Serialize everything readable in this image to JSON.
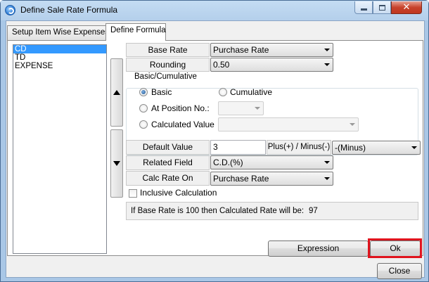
{
  "window": {
    "title": "Define Sale Rate Formula"
  },
  "tabs": [
    {
      "label": "Setup Item Wise Expenses",
      "active": false
    },
    {
      "label": "Define Formula",
      "active": true
    }
  ],
  "list": {
    "items": [
      "CD",
      "TD",
      "EXPENSE"
    ],
    "selected": "CD"
  },
  "form": {
    "base_rate": {
      "label": "Base Rate",
      "value": "Purchase Rate"
    },
    "rounding": {
      "label": "Rounding",
      "value": "0.50"
    },
    "basic_cumulative": {
      "title": "Basic/Cumulative",
      "basic": "Basic",
      "cumulative": "Cumulative",
      "at_position": "At Position No.:",
      "at_position_value": "",
      "calculated_value": "Calculated Value",
      "calculated_value_value": "",
      "selected": "Basic"
    },
    "default_value": {
      "label": "Default Value",
      "value": "3"
    },
    "plus_minus": {
      "label": "Plus(+) / Minus(-)",
      "value": "-(Minus)"
    },
    "related_field": {
      "label": "Related Field",
      "value": "C.D.(%)"
    },
    "calc_rate_on": {
      "label": "Calc Rate On",
      "value": "Purchase Rate"
    },
    "inclusive": {
      "label": "Inclusive Calculation",
      "checked": false
    },
    "info": {
      "text": "If Base Rate is 100 then Calculated Rate will be:",
      "value": "97"
    }
  },
  "buttons": {
    "expression": "Expression",
    "ok": "Ok",
    "close": "Close"
  },
  "colors": {
    "selection": "#3399ff",
    "highlight": "#e0141e"
  }
}
